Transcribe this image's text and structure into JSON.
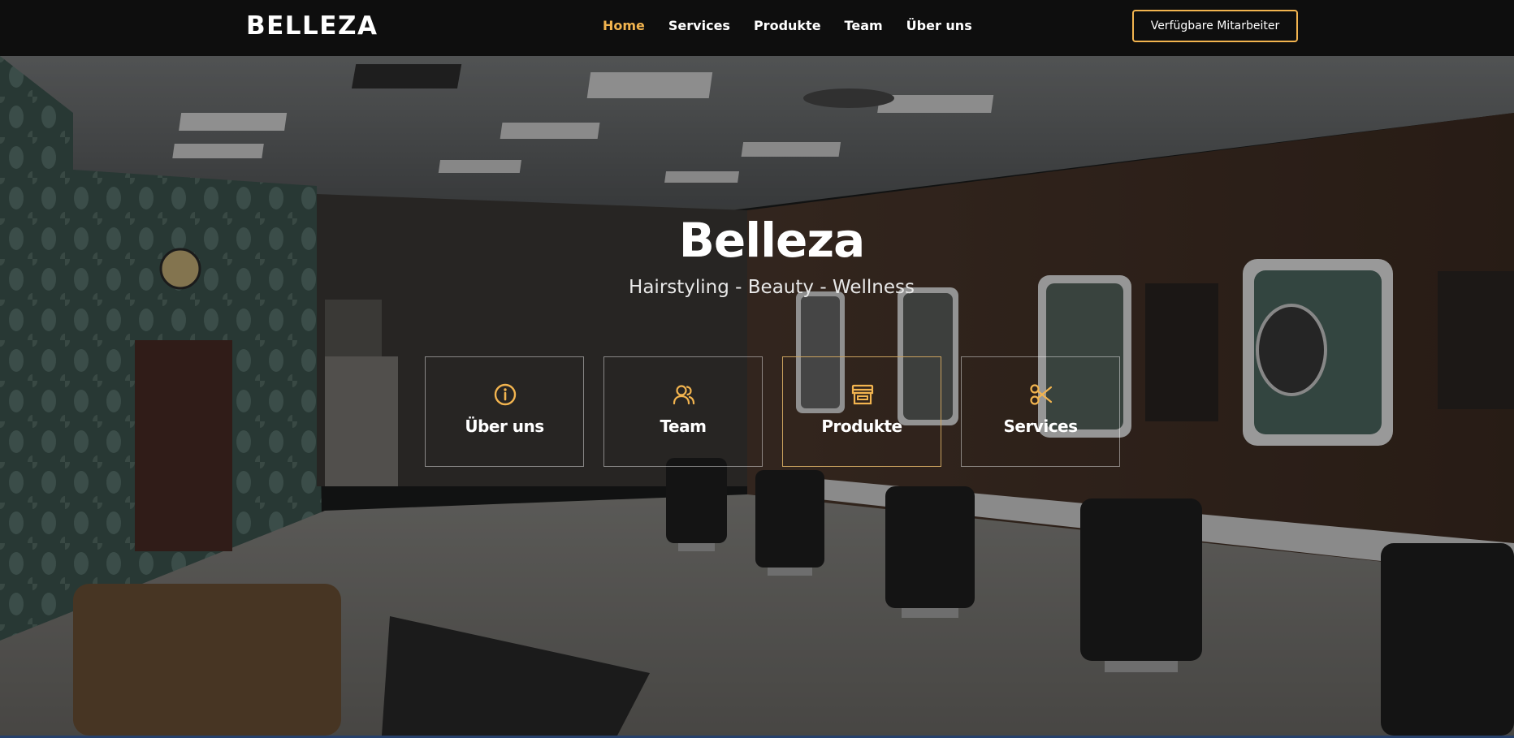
{
  "header": {
    "logo": "BELLEZA",
    "nav": [
      {
        "label": "Home",
        "active": true
      },
      {
        "label": "Services",
        "active": false
      },
      {
        "label": "Produkte",
        "active": false
      },
      {
        "label": "Team",
        "active": false
      },
      {
        "label": "Über uns",
        "active": false
      }
    ],
    "cta_label": "Verfügbare Mitarbeiter"
  },
  "hero": {
    "title": "Belleza",
    "subtitle": "Hairstyling - Beauty - Wellness",
    "tiles": [
      {
        "label": "Über uns",
        "icon": "info-icon"
      },
      {
        "label": "Team",
        "icon": "users-icon"
      },
      {
        "label": "Produkte",
        "icon": "store-icon"
      },
      {
        "label": "Services",
        "icon": "scissors-icon"
      }
    ]
  },
  "colors": {
    "accent": "#f2b44f",
    "header_bg": "#0e0e0e",
    "text": "#ffffff"
  }
}
